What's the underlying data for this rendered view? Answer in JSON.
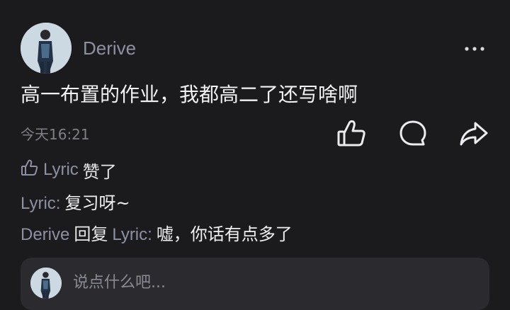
{
  "post": {
    "username": "Derive",
    "content": "高一布置的作业，我都高二了还写啥啊",
    "time": "今天16:21"
  },
  "likes": {
    "name": "Lyric",
    "suffix": "赞了"
  },
  "comments": [
    {
      "author": "Lyric",
      "separator": ":",
      "text": "复习呀~"
    },
    {
      "author": "Derive",
      "reply_word": "回复",
      "reply_to": "Lyric",
      "separator": ":",
      "text": "嘘，你话有点多了"
    }
  ],
  "comment_input": {
    "placeholder": "说点什么吧..."
  },
  "icons": {
    "more": "more-icon",
    "like": "thumbs-up-icon",
    "comment": "comment-icon",
    "share": "share-icon",
    "like_small": "thumbs-up-small-icon"
  }
}
